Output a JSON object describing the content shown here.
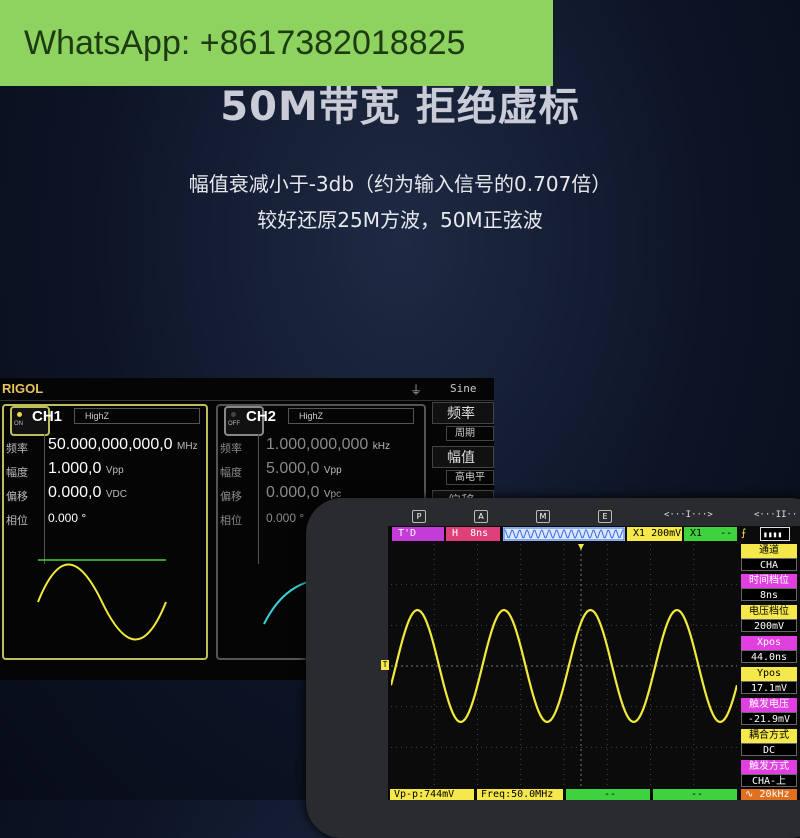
{
  "overlay": {
    "text": "WhatsApp: +8617382018825"
  },
  "promo": {
    "headline": "50M带宽 拒绝虚标",
    "line1": "幅值衰减小于-3db（约为输入信号的0.707倍）",
    "line2": "较好还原25M方波，50M正弦波"
  },
  "generator": {
    "brand": "RIGOL",
    "usb_icon": "usb-icon",
    "wave_type": "Sine",
    "ch1": {
      "name": "CH1",
      "state": "ON",
      "impedance": "HighZ",
      "params": [
        {
          "label": "频率",
          "value": "50.000,000,000,0",
          "unit": "MHz"
        },
        {
          "label": "幅度",
          "value": "1.000,0",
          "unit": "Vpp"
        },
        {
          "label": "偏移",
          "value": "0.000,0",
          "unit": "VDC"
        },
        {
          "label": "相位",
          "value": "0.000",
          "unit": "°"
        }
      ]
    },
    "ch2": {
      "name": "CH2",
      "state": "OFF",
      "impedance": "HighZ",
      "params": [
        {
          "label": "频率",
          "value": "1.000,000,000",
          "unit": "kHz"
        },
        {
          "label": "幅度",
          "value": "5.000,0",
          "unit": "Vpp"
        },
        {
          "label": "偏移",
          "value": "0.000,0",
          "unit": "Vpc"
        },
        {
          "label": "相位",
          "value": "0.000",
          "unit": "°"
        }
      ]
    },
    "menu": {
      "freq": "频率",
      "period": "周期",
      "amp": "幅值",
      "high_level": "高电平",
      "offset": "偏移"
    }
  },
  "scope": {
    "tabs": [
      "P",
      "A",
      "M",
      "E"
    ],
    "cursor1": "<···I···>",
    "cursor2": "<···II··",
    "status": {
      "trig_mode": "T'D",
      "timebase_tag": "H",
      "timebase": "8ns",
      "ch_tag": "X1",
      "volt": "200mV",
      "ch2_tag": "X1",
      "ch2_val": "--"
    },
    "side": [
      {
        "label": "通道",
        "value": "CHA",
        "color": "#f5e84a"
      },
      {
        "label": "时间档位",
        "value": "8ns",
        "color": "#e040e0"
      },
      {
        "label": "电压档位",
        "value": "200mV",
        "color": "#f5e84a"
      },
      {
        "label": "Xpos",
        "value": "44.0ns",
        "color": "#e040e0"
      },
      {
        "label": "Ypos",
        "value": "17.1mV",
        "color": "#f5e84a"
      },
      {
        "label": "触发电压",
        "value": "-21.9mV",
        "color": "#e040e0"
      },
      {
        "label": "耦合方式",
        "value": "DC",
        "color": "#f5e84a"
      },
      {
        "label": "触发方式",
        "value": "CHA-上",
        "color": "#e040e0"
      }
    ],
    "bottom": {
      "vpp": "Vp-p:744mV",
      "freq": "Freq:50.0MHz",
      "m3": "--",
      "m4": "--",
      "m5": "--",
      "trig_freq": "20kHz"
    },
    "colors": {
      "trace": "#f2ea3a",
      "yellow": "#f5e84a",
      "magenta": "#e040e0",
      "green": "#3fd23f",
      "blue": "#2f6ee0"
    }
  }
}
